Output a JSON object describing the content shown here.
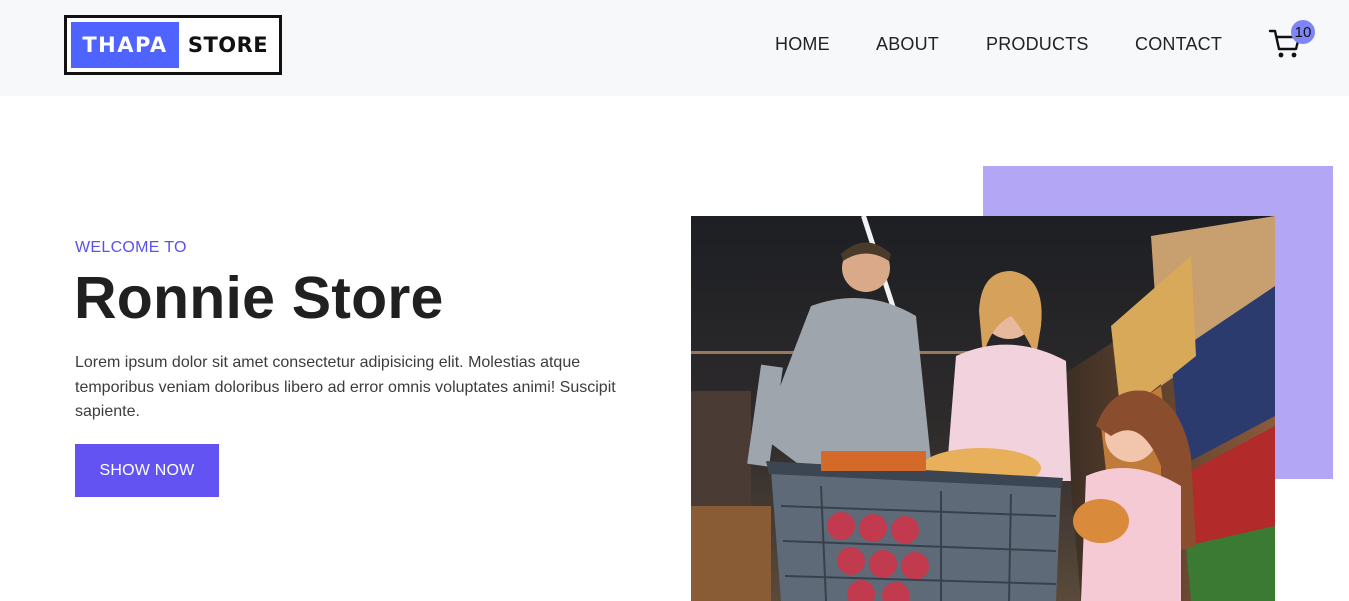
{
  "header": {
    "logo": {
      "part1": "THAPA",
      "part2": "STORE"
    },
    "nav": [
      {
        "label": "HOME"
      },
      {
        "label": "ABOUT"
      },
      {
        "label": "PRODUCTS"
      },
      {
        "label": "CONTACT"
      }
    ],
    "cart": {
      "icon": "cart-icon",
      "count": "10"
    }
  },
  "hero": {
    "intro": "WELCOME TO",
    "title": "Ronnie Store",
    "description": "Lorem ipsum dolor sit amet consectetur adipisicing elit. Molestias atque temporibus veniam doloribus libero ad error omnis voluptates animi! Suscipit sapiente.",
    "button_label": "SHOW NOW",
    "image": "family-grocery-shopping-photo"
  },
  "colors": {
    "brand": "#4f63ff",
    "accent": "#6353f3",
    "accent_box": "#b3a7f5",
    "header_bg": "#f6f8fa"
  }
}
